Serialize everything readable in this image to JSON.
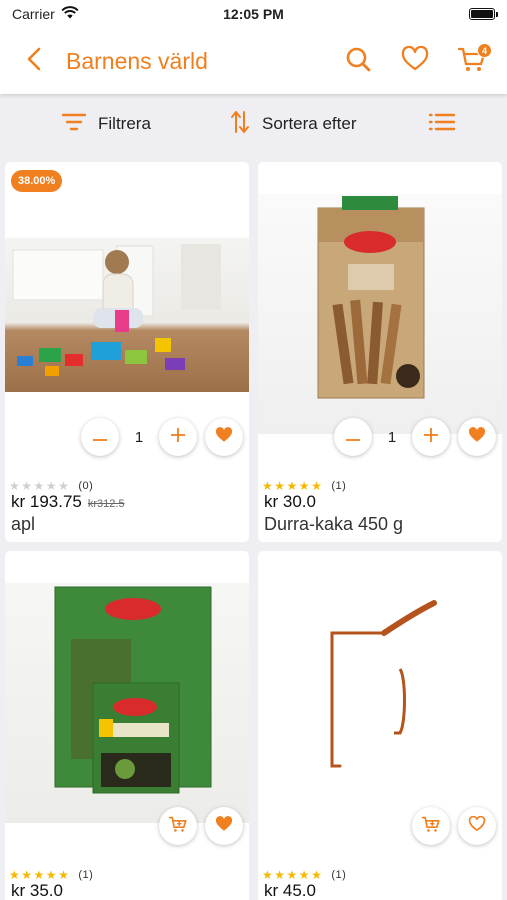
{
  "status": {
    "carrier": "Carrier",
    "time": "12:05 PM"
  },
  "header": {
    "title": "Barnens värld",
    "cart_count": "4"
  },
  "toolbar": {
    "filter_label": "Filtrera",
    "sort_label": "Sortera efter"
  },
  "colors": {
    "accent": "#f07f1f",
    "star": "#f5b800"
  },
  "products": [
    {
      "discount": "38.00%",
      "qty": "1",
      "rating_count": "(0)",
      "price": "kr 193.75",
      "old_price": "kr312.5",
      "name": "apl",
      "stars": 0
    },
    {
      "qty": "1",
      "rating_count": "(1)",
      "price": "kr 30.0",
      "name": "Durra-kaka 450 g",
      "stars": 5
    },
    {
      "rating_count": "(1)",
      "price": "kr 35.0",
      "stars": 5
    },
    {
      "rating_count": "(1)",
      "price": "kr 45.0",
      "stars": 5
    }
  ],
  "icons": [
    "back-icon",
    "search-icon",
    "heart-icon",
    "cart-icon",
    "filter-icon",
    "sort-icon",
    "list-view-icon",
    "minus-icon",
    "plus-icon",
    "add-to-cart-icon"
  ]
}
